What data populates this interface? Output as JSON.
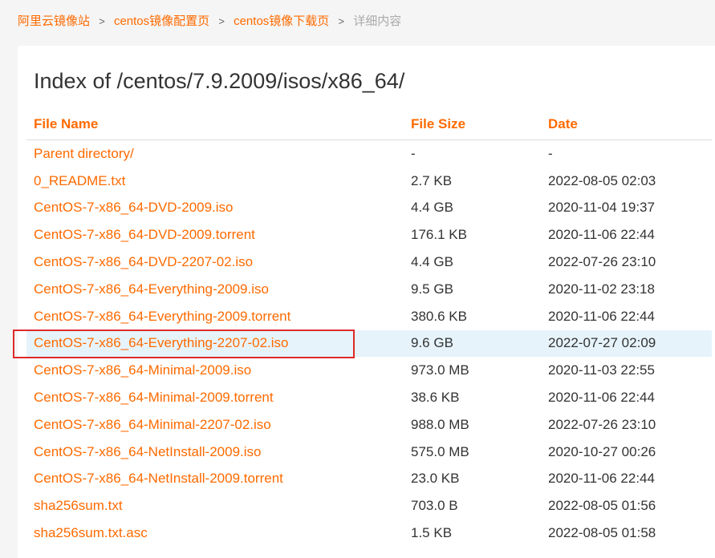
{
  "breadcrumb": {
    "items": [
      "阿里云镜像站",
      "centos镜像配置页",
      "centos镜像下载页"
    ],
    "separator": ">",
    "current": "详细内容"
  },
  "title": "Index of /centos/7.9.2009/isos/x86_64/",
  "table": {
    "headers": {
      "name": "File Name",
      "size": "File Size",
      "date": "Date"
    },
    "rows": [
      {
        "name": "Parent directory/",
        "size": "-",
        "date": "-"
      },
      {
        "name": "0_README.txt",
        "size": "2.7 KB",
        "date": "2022-08-05 02:03"
      },
      {
        "name": "CentOS-7-x86_64-DVD-2009.iso",
        "size": "4.4 GB",
        "date": "2020-11-04 19:37"
      },
      {
        "name": "CentOS-7-x86_64-DVD-2009.torrent",
        "size": "176.1 KB",
        "date": "2020-11-06 22:44"
      },
      {
        "name": "CentOS-7-x86_64-DVD-2207-02.iso",
        "size": "4.4 GB",
        "date": "2022-07-26 23:10"
      },
      {
        "name": "CentOS-7-x86_64-Everything-2009.iso",
        "size": "9.5 GB",
        "date": "2020-11-02 23:18"
      },
      {
        "name": "CentOS-7-x86_64-Everything-2009.torrent",
        "size": "380.6 KB",
        "date": "2020-11-06 22:44"
      },
      {
        "name": "CentOS-7-x86_64-Everything-2207-02.iso",
        "size": "9.6 GB",
        "date": "2022-07-27 02:09",
        "highlighted": true
      },
      {
        "name": "CentOS-7-x86_64-Minimal-2009.iso",
        "size": "973.0 MB",
        "date": "2020-11-03 22:55"
      },
      {
        "name": "CentOS-7-x86_64-Minimal-2009.torrent",
        "size": "38.6 KB",
        "date": "2020-11-06 22:44"
      },
      {
        "name": "CentOS-7-x86_64-Minimal-2207-02.iso",
        "size": "988.0 MB",
        "date": "2022-07-26 23:10"
      },
      {
        "name": "CentOS-7-x86_64-NetInstall-2009.iso",
        "size": "575.0 MB",
        "date": "2020-10-27 00:26"
      },
      {
        "name": "CentOS-7-x86_64-NetInstall-2009.torrent",
        "size": "23.0 KB",
        "date": "2020-11-06 22:44"
      },
      {
        "name": "sha256sum.txt",
        "size": "703.0 B",
        "date": "2022-08-05 01:56"
      },
      {
        "name": "sha256sum.txt.asc",
        "size": "1.5 KB",
        "date": "2022-08-05 01:58"
      }
    ]
  },
  "colors": {
    "accent": "#ff6a00",
    "highlight_row": "#e6f3fb",
    "annotation_box": "#e02a2a"
  }
}
